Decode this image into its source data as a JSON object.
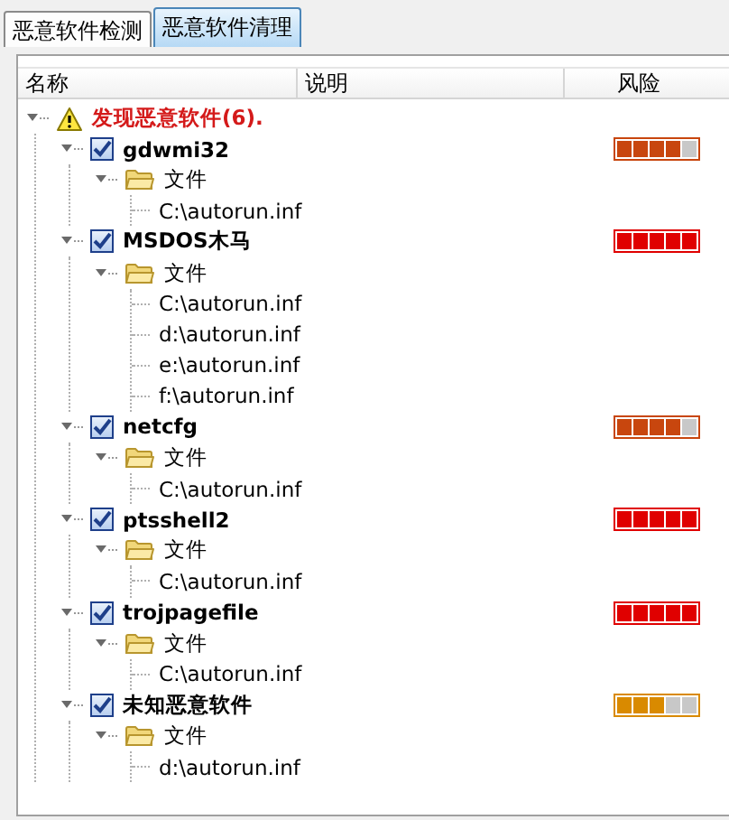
{
  "tabs": [
    {
      "label": "恶意软件检测",
      "selected": false
    },
    {
      "label": "恶意软件清理",
      "selected": true
    }
  ],
  "columns": [
    "名称",
    "说明",
    "风险"
  ],
  "tree": [
    {
      "kind": "group",
      "label": "发现恶意软件(6).",
      "expanded": true,
      "children": [
        {
          "kind": "malware",
          "label": "gdwmi32",
          "checked": true,
          "expanded": true,
          "level": 0.8,
          "color": "#c8460e",
          "children": [
            {
              "kind": "folder",
              "label": "文件",
              "expanded": true,
              "children": [
                {
                  "kind": "file",
                  "label": "C:\\autorun.inf"
                }
              ]
            }
          ]
        },
        {
          "kind": "malware",
          "label": "MSDOS木马",
          "checked": true,
          "expanded": true,
          "level": 1,
          "color": "#e00000",
          "children": [
            {
              "kind": "folder",
              "label": "文件",
              "expanded": true,
              "children": [
                {
                  "kind": "file",
                  "label": "C:\\autorun.inf"
                },
                {
                  "kind": "file",
                  "label": "d:\\autorun.inf"
                },
                {
                  "kind": "file",
                  "label": "e:\\autorun.inf"
                },
                {
                  "kind": "file",
                  "label": "f:\\autorun.inf"
                }
              ]
            }
          ]
        },
        {
          "kind": "malware",
          "label": "netcfg",
          "checked": true,
          "expanded": true,
          "level": 0.8,
          "color": "#c8460e",
          "children": [
            {
              "kind": "folder",
              "label": "文件",
              "expanded": true,
              "children": [
                {
                  "kind": "file",
                  "label": "C:\\autorun.inf"
                }
              ]
            }
          ]
        },
        {
          "kind": "malware",
          "label": "ptsshell2",
          "checked": true,
          "expanded": true,
          "level": 1,
          "color": "#e00000",
          "children": [
            {
              "kind": "folder",
              "label": "文件",
              "expanded": true,
              "children": [
                {
                  "kind": "file",
                  "label": "C:\\autorun.inf"
                }
              ]
            }
          ]
        },
        {
          "kind": "malware",
          "label": "trojpagefile",
          "checked": true,
          "expanded": true,
          "level": 1,
          "color": "#e00000",
          "children": [
            {
              "kind": "folder",
              "label": "文件",
              "expanded": true,
              "children": [
                {
                  "kind": "file",
                  "label": "C:\\autorun.inf"
                }
              ]
            }
          ]
        },
        {
          "kind": "malware",
          "label": "未知恶意软件",
          "checked": true,
          "expanded": true,
          "level": 0.6,
          "color": "#d98a00",
          "children": [
            {
              "kind": "folder",
              "label": "文件",
              "expanded": true,
              "children": [
                {
                  "kind": "file",
                  "label": "d:\\autorun.inf"
                }
              ]
            }
          ]
        }
      ]
    }
  ]
}
